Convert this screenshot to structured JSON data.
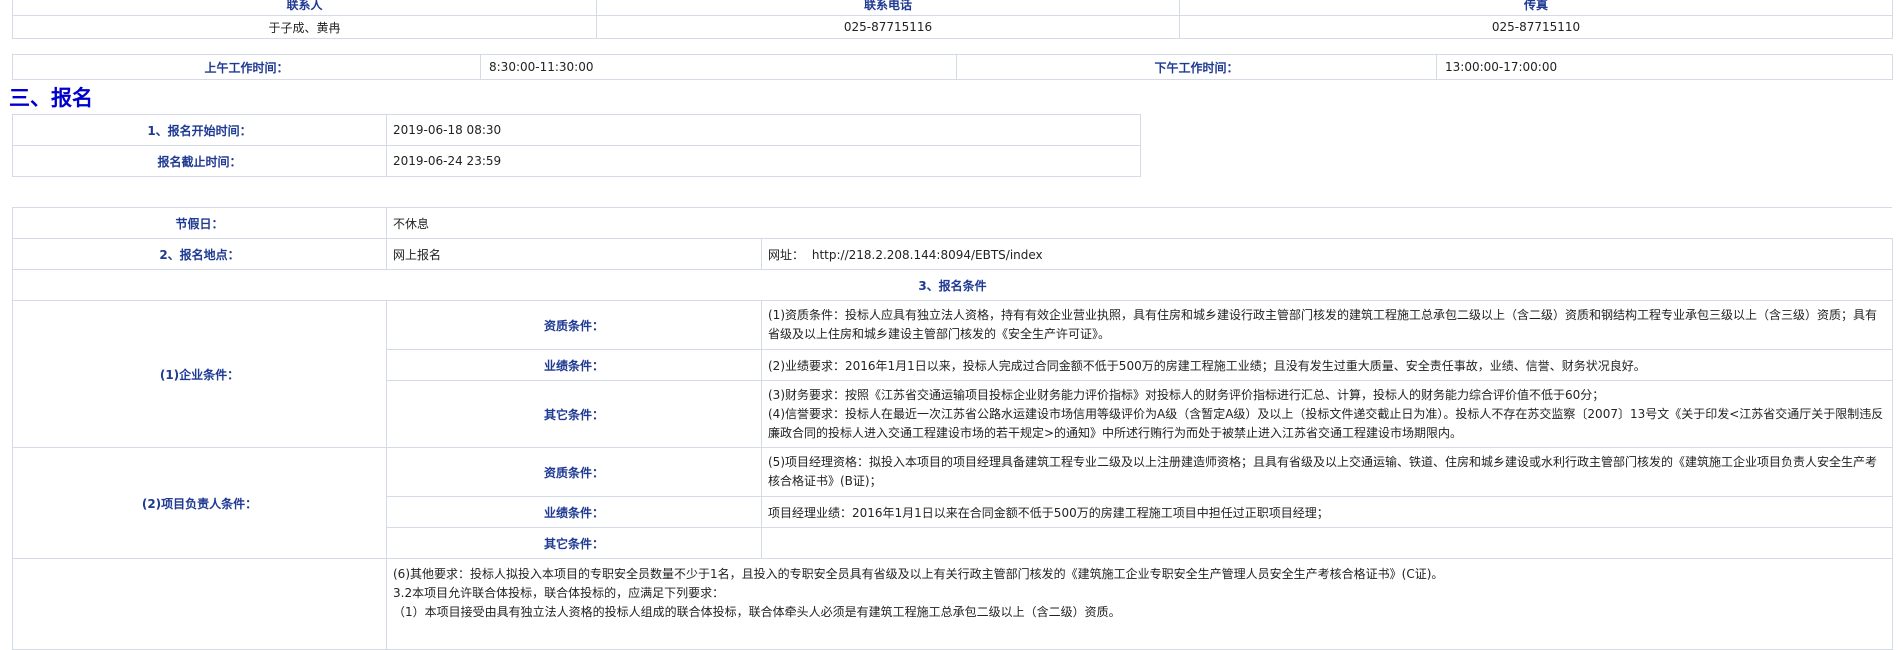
{
  "contact": {
    "headers": [
      "联系人",
      "联系电话",
      "传真"
    ],
    "values": [
      "于子成、黄冉",
      "025-87715116",
      "025-87715110"
    ]
  },
  "hours": {
    "am_label": "上午工作时间：",
    "am_value": "8:30:00-11:30:00",
    "pm_label": "下午工作时间：",
    "pm_value": "13:00:00-17:00:00"
  },
  "section_title": "三、报名",
  "registration": {
    "start_label": "1、报名开始时间：",
    "start_value": "2019-06-18 08:30",
    "end_label": "报名截止时间：",
    "end_value": "2019-06-24 23:59",
    "holiday_label": "节假日：",
    "holiday_value": "不休息",
    "place_label": "2、报名地点：",
    "place_value": "网上报名",
    "url_label": "网址：",
    "url_value": "http://218.2.208.144:8094/EBTS/index",
    "conditions_title": "3、报名条件"
  },
  "enterprise": {
    "label": "(1)企业条件：",
    "qual_label": "资质条件：",
    "qual_text": "(1)资质条件：投标人应具有独立法人资格，持有有效企业营业执照，具有住房和城乡建设行政主管部门核发的建筑工程施工总承包二级以上（含二级）资质和钢结构工程专业承包三级以上（含三级）资质；具有省级及以上住房和城乡建设主管部门核发的《安全生产许可证》。",
    "perf_label": "业绩条件：",
    "perf_text": "(2)业绩要求：2016年1月1日以来，投标人完成过合同金额不低于500万的房建工程施工业绩；且没有发生过重大质量、安全责任事故，业绩、信誉、财务状况良好。",
    "other_label": "其它条件：",
    "other_text_1": "(3)财务要求：按照《江苏省交通运输项目投标企业财务能力评价指标》对投标人的财务评价指标进行汇总、计算，投标人的财务能力综合评价值不低于60分；",
    "other_text_2": "(4)信誉要求：投标人在最近一次江苏省公路水运建设市场信用等级评价为A级（含暂定A级）及以上（投标文件递交截止日为准）。投标人不存在苏交监察〔2007〕13号文《关于印发<江苏省交通厅关于限制违反廉政合同的投标人进入交通工程建设市场的若干规定>的通知》中所述行贿行为而处于被禁止进入江苏省交通工程建设市场期限内。"
  },
  "manager": {
    "label": "(2)项目负责人条件：",
    "qual_label": "资质条件：",
    "qual_text": "(5)项目经理资格：拟投入本项目的项目经理具备建筑工程专业二级及以上注册建造师资格；且具有省级及以上交通运输、铁道、住房和城乡建设或水利行政主管部门核发的《建筑施工企业项目负责人安全生产考核合格证书》(B证)；",
    "perf_label": "业绩条件：",
    "perf_text": "项目经理业绩：2016年1月1日以来在合同金额不低于500万的房建工程施工项目中担任过正职项目经理；",
    "other_label": "其它条件：",
    "other_text": ""
  },
  "other_requirements": {
    "line_1": "(6)其他要求：投标人拟投入本项目的专职安全员数量不少于1名，且投入的专职安全员具有省级及以上有关行政主管部门核发的《建筑施工企业专职安全生产管理人员安全生产考核合格证书》(C证)。",
    "line_2": "3.2本项目允许联合体投标，联合体投标的，应满足下列要求：",
    "line_3": "（1）本项目接受由具有独立法人资格的投标人组成的联合体投标，联合体牵头人必须是有建筑工程施工总承包二级以上（含二级）资质。"
  }
}
